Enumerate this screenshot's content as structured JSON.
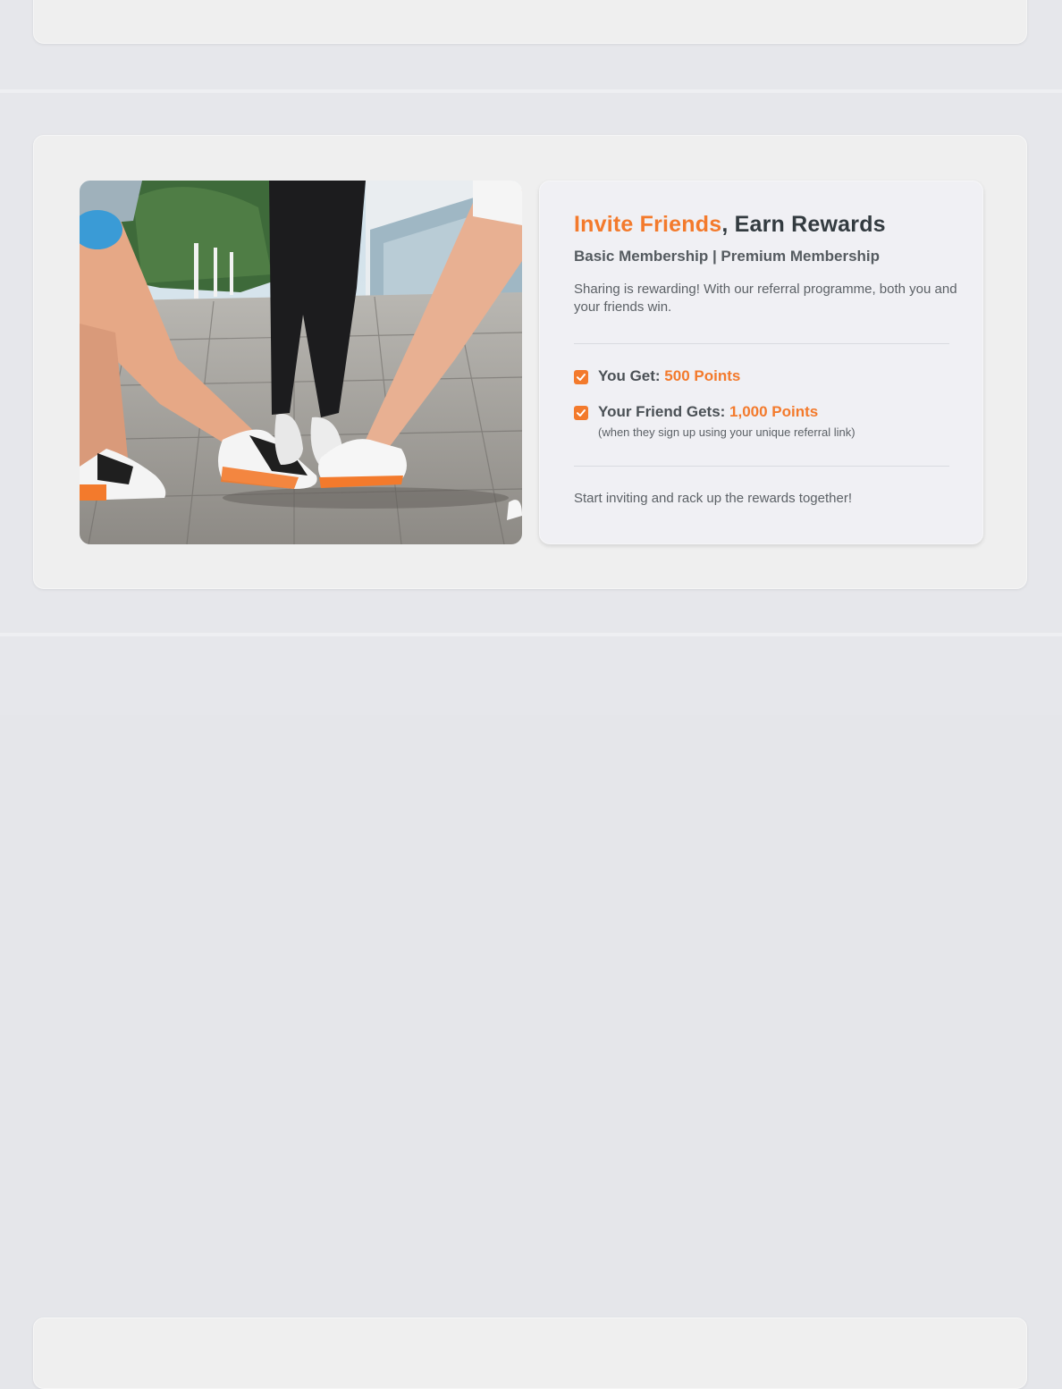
{
  "referral": {
    "title_highlight": "Invite Friends",
    "title_rest": ", Earn Rewards",
    "subtitle": "Basic Membership | Premium Membership",
    "description": "Sharing is rewarding! With our referral programme, both you and your friends win.",
    "benefits": [
      {
        "label": "You Get: ",
        "value": "500 Points"
      },
      {
        "label": "Your Friend Gets: ",
        "value": "1,000 Points",
        "note": "(when they sign up using your unique referral link)"
      }
    ],
    "footer": "Start inviting and rack up the rewards together!"
  },
  "photo": {
    "icon": "three-friends-sneakers-photo"
  },
  "colors": {
    "accent": "#f37a2c",
    "text": "#333b40",
    "card": "#f0f0f4",
    "page": "#e6e7eb"
  }
}
